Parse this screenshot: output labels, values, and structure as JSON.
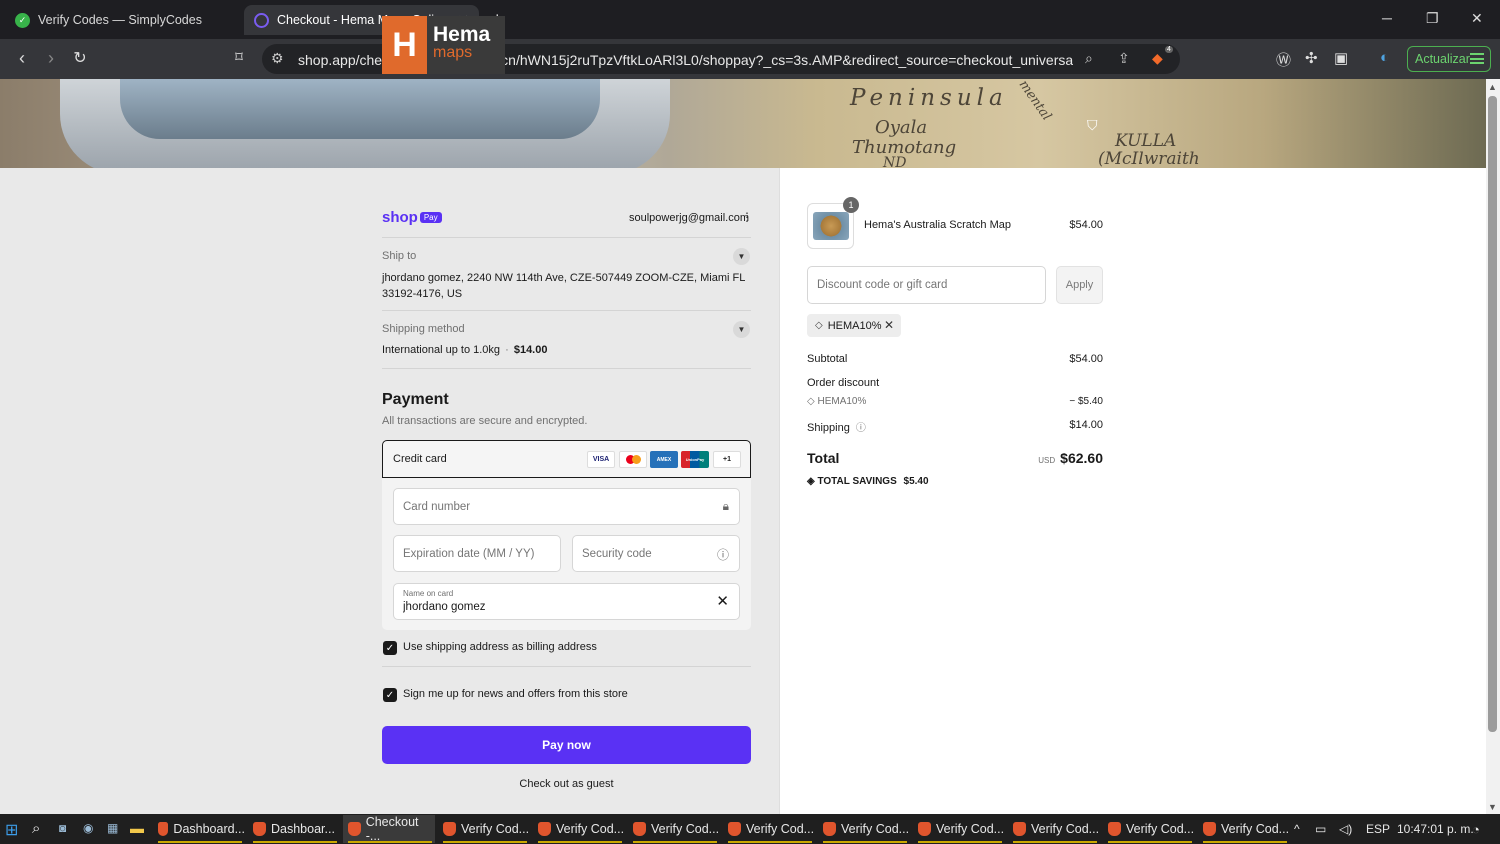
{
  "browser": {
    "tabs": [
      {
        "label": "Verify Codes — SimplyCodes",
        "active": false
      },
      {
        "label": "Checkout - Hema Maps Online S",
        "active": true
      }
    ],
    "url": "shop.app/checkout/3254452342/cn/hWN15j2ruTpzVftkLoARl3L0/shoppay?_cs=3s.AMP&redirect_source=checkout_universal_r...",
    "brave_badge": "4",
    "update_button": "Actualizar"
  },
  "banner": {
    "logo_mark": "H",
    "logo_name": "Hema",
    "logo_sub": "maps",
    "map_labels": [
      "Peninsula",
      "Oyala",
      "Thumotang",
      "KULLA",
      "(McIlwraith",
      "ND",
      "mental"
    ]
  },
  "checkout": {
    "shop_pay": {
      "brand": "shop",
      "badge": "Pay"
    },
    "email": "soulpowerjg@gmail.com",
    "ship_to": {
      "label": "Ship to",
      "address": "jhordano gomez, 2240 NW 114th Ave, CZE-507449 ZOOM-CZE, Miami FL 33192-4176, US"
    },
    "shipping_method": {
      "label": "Shipping method",
      "value": "International up to 1.0kg",
      "price": "$14.00"
    },
    "payment": {
      "title": "Payment",
      "subtitle": "All transactions are secure and encrypted.",
      "method_label": "Credit card",
      "card_brands": [
        "VISA",
        "MC",
        "AMEX",
        "UnionPay"
      ],
      "more_cards": "+1",
      "card_number_placeholder": "Card number",
      "expiry_placeholder": "Expiration date (MM / YY)",
      "security_placeholder": "Security code",
      "name_label": "Name on card",
      "name_value": "jhordano gomez"
    },
    "billing_checkbox": "Use shipping address as billing address",
    "news_checkbox": "Sign me up for news and offers from this store",
    "pay_button": "Pay now",
    "guest_link": "Check out as guest"
  },
  "summary": {
    "item": {
      "name": "Hema's Australia Scratch Map",
      "price": "$54.00",
      "quantity": "1"
    },
    "discount_placeholder": "Discount code or gift card",
    "apply_button": "Apply",
    "applied_code": "HEMA10%",
    "subtotal_label": "Subtotal",
    "subtotal": "$54.00",
    "order_discount_label": "Order discount",
    "discount_code": "HEMA10%",
    "discount_amount": "− $5.40",
    "shipping_label": "Shipping",
    "shipping": "$14.00",
    "total_label": "Total",
    "currency": "USD",
    "total": "$62.60",
    "savings_label": "TOTAL SAVINGS",
    "savings": "$5.40"
  },
  "taskbar": {
    "items": [
      {
        "label": "Dashboard...",
        "active": false
      },
      {
        "label": "Dashboar...",
        "active": false
      },
      {
        "label": "Checkout -...",
        "active": true
      },
      {
        "label": "Verify Cod...",
        "active": false
      },
      {
        "label": "Verify Cod...",
        "active": false
      },
      {
        "label": "Verify Cod...",
        "active": false
      },
      {
        "label": "Verify Cod...",
        "active": false
      },
      {
        "label": "Verify Cod...",
        "active": false
      },
      {
        "label": "Verify Cod...",
        "active": false
      },
      {
        "label": "Verify Cod...",
        "active": false
      },
      {
        "label": "Verify Cod...",
        "active": false
      },
      {
        "label": "Verify Cod...",
        "active": false
      }
    ],
    "language": "ESP",
    "time": "10:47:01 p. m."
  },
  "colors": {
    "accent": "#5a31f4",
    "brand_orange": "#e06a2c",
    "update_green": "#4caf50"
  }
}
